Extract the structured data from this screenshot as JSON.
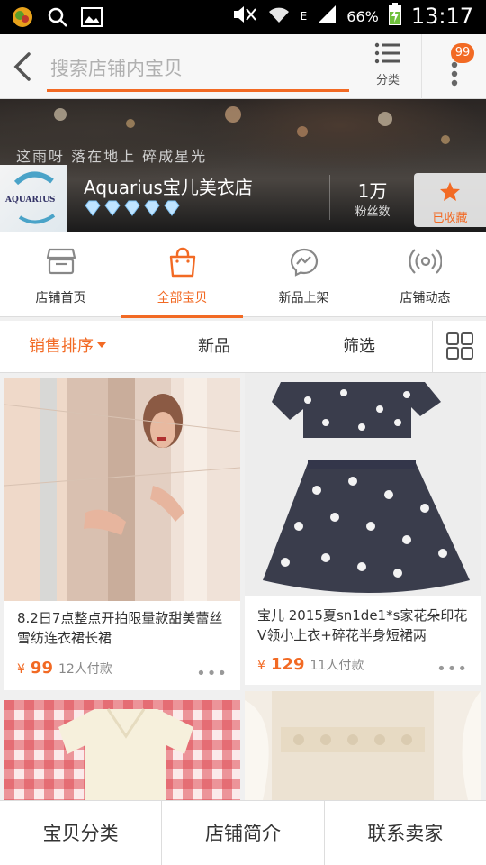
{
  "status_bar": {
    "battery": "66%",
    "network": "E",
    "time": "13:17"
  },
  "search": {
    "placeholder": "搜索店铺内宝贝",
    "category_label": "分类",
    "badge_count": "99"
  },
  "banner": {
    "slogan": "这雨呀 落在地上 碎成星光",
    "logo_text": "AQUARIUS",
    "store_name": "Aquarius宝儿美衣店",
    "diamond_count": 5,
    "fans_count": "1万",
    "fans_label": "粉丝数",
    "favorite_label": "已收藏"
  },
  "nav_tabs": [
    {
      "label": "店铺首页",
      "icon": "store-icon"
    },
    {
      "label": "全部宝贝",
      "icon": "shopping-bag-icon",
      "active": true
    },
    {
      "label": "新品上架",
      "icon": "messenger-icon"
    },
    {
      "label": "店铺动态",
      "icon": "broadcast-icon"
    }
  ],
  "sort_bar": {
    "sales_sort": "销售排序",
    "new": "新品",
    "filter": "筛选",
    "grid_icon": "grid-view-icon"
  },
  "products": [
    {
      "title": "8.2日7点整点开拍限量款甜美蕾丝雪纺连衣裙长裙",
      "currency": "¥",
      "price": "99",
      "sold": "12人付款"
    },
    {
      "title": "宝儿 2015夏sn1de1*s家花朵印花V领小上衣+碎花半身短裙两",
      "currency": "¥",
      "price": "129",
      "sold": "11人付款"
    },
    {
      "title": "",
      "currency": "",
      "price": "",
      "sold": ""
    },
    {
      "title": "",
      "currency": "",
      "price": "",
      "sold": ""
    }
  ],
  "bottom_bar": {
    "categories": "宝贝分类",
    "store_intro": "店铺简介",
    "contact": "联系卖家"
  },
  "colors": {
    "accent": "#f26a24",
    "status_bar": "#000000",
    "text": "#333333"
  }
}
